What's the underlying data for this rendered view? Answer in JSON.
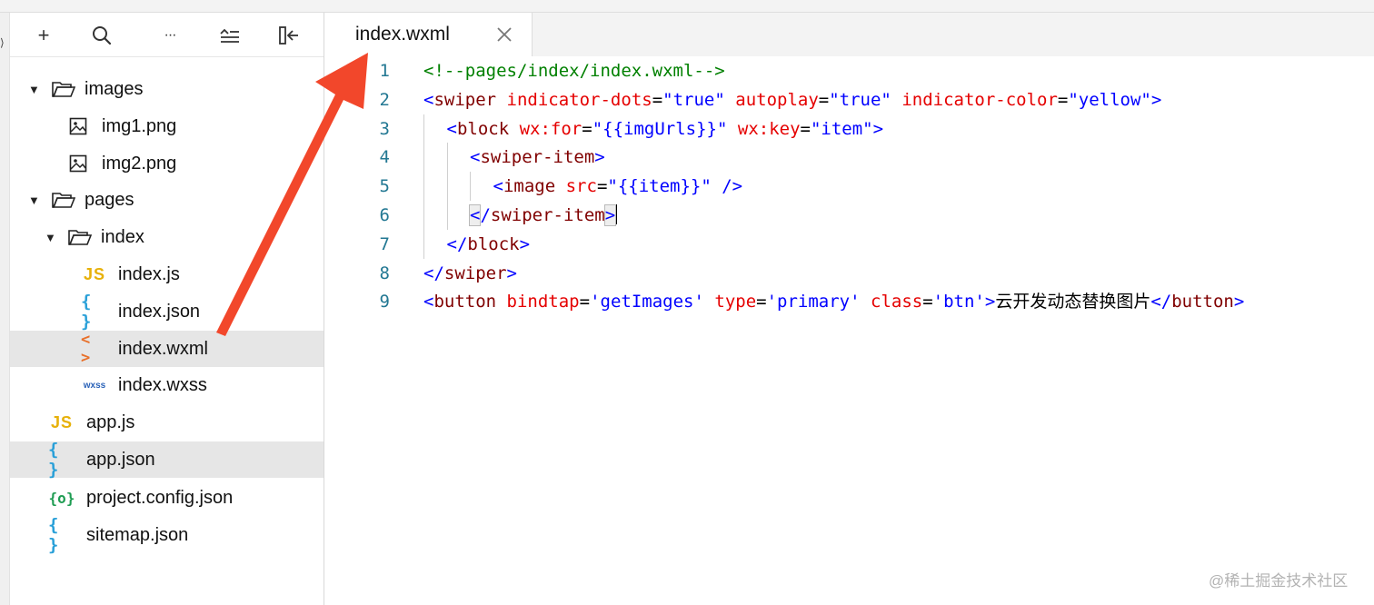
{
  "sidebar": {
    "toolbar": {
      "add": "+",
      "more": "···"
    },
    "tree": [
      {
        "label": "images",
        "type": "folder"
      },
      {
        "label": "img1.png",
        "type": "image"
      },
      {
        "label": "img2.png",
        "type": "image"
      },
      {
        "label": "pages",
        "type": "folder"
      },
      {
        "label": "index",
        "type": "folder"
      },
      {
        "label": "index.js",
        "type": "js",
        "icon": "JS"
      },
      {
        "label": "index.json",
        "type": "json",
        "icon": "{ }"
      },
      {
        "label": "index.wxml",
        "type": "wxml",
        "icon": "< >",
        "selected": true
      },
      {
        "label": "index.wxss",
        "type": "wxss",
        "icon": "wxss"
      },
      {
        "label": "app.js",
        "type": "js",
        "icon": "JS"
      },
      {
        "label": "app.json",
        "type": "json",
        "icon": "{ }",
        "highlighted": true
      },
      {
        "label": "project.config.json",
        "type": "config",
        "icon": "{o}"
      },
      {
        "label": "sitemap.json",
        "type": "json",
        "icon": "{ }"
      }
    ]
  },
  "editor": {
    "tab": {
      "title": "index.wxml"
    },
    "line_numbers": [
      "1",
      "2",
      "3",
      "4",
      "5",
      "6",
      "7",
      "8",
      "9"
    ],
    "lines": [
      [
        {
          "c": "comment",
          "t": "<!--pages/index/index.wxml-->"
        }
      ],
      [
        {
          "c": "br",
          "t": "<"
        },
        {
          "c": "tag",
          "t": "swiper"
        },
        {
          "c": "eq",
          "t": " "
        },
        {
          "c": "attr",
          "t": "indicator-dots"
        },
        {
          "c": "eq",
          "t": "="
        },
        {
          "c": "str",
          "t": "\"true\""
        },
        {
          "c": "eq",
          "t": " "
        },
        {
          "c": "attr",
          "t": "autoplay"
        },
        {
          "c": "eq",
          "t": "="
        },
        {
          "c": "str",
          "t": "\"true\""
        },
        {
          "c": "eq",
          "t": " "
        },
        {
          "c": "attr",
          "t": "indicator-color"
        },
        {
          "c": "eq",
          "t": "="
        },
        {
          "c": "str",
          "t": "\"yellow\""
        },
        {
          "c": "br",
          "t": ">"
        }
      ],
      [
        {
          "c": "br",
          "t": "<"
        },
        {
          "c": "tag",
          "t": "block"
        },
        {
          "c": "eq",
          "t": " "
        },
        {
          "c": "attr",
          "t": "wx:for"
        },
        {
          "c": "eq",
          "t": "="
        },
        {
          "c": "str",
          "t": "\"{{imgUrls}}\""
        },
        {
          "c": "eq",
          "t": " "
        },
        {
          "c": "attr",
          "t": "wx:key"
        },
        {
          "c": "eq",
          "t": "="
        },
        {
          "c": "str",
          "t": "\"item\""
        },
        {
          "c": "br",
          "t": ">"
        }
      ],
      [
        {
          "c": "br",
          "t": "<"
        },
        {
          "c": "tag",
          "t": "swiper-item"
        },
        {
          "c": "br",
          "t": ">"
        }
      ],
      [
        {
          "c": "br",
          "t": "<"
        },
        {
          "c": "tag",
          "t": "image"
        },
        {
          "c": "eq",
          "t": " "
        },
        {
          "c": "attr",
          "t": "src"
        },
        {
          "c": "eq",
          "t": "="
        },
        {
          "c": "str",
          "t": "\"{{item}}\""
        },
        {
          "c": "eq",
          "t": " "
        },
        {
          "c": "br",
          "t": "/>"
        }
      ],
      [
        {
          "c": "br",
          "t": "<",
          "bm": true
        },
        {
          "c": "br",
          "t": "/"
        },
        {
          "c": "tag",
          "t": "swiper-item"
        },
        {
          "c": "br",
          "t": ">",
          "bm": true
        },
        {
          "c": "cursor",
          "t": ""
        }
      ],
      [
        {
          "c": "br",
          "t": "</"
        },
        {
          "c": "tag",
          "t": "block"
        },
        {
          "c": "br",
          "t": ">"
        }
      ],
      [
        {
          "c": "br",
          "t": "</"
        },
        {
          "c": "tag",
          "t": "swiper"
        },
        {
          "c": "br",
          "t": ">"
        }
      ],
      [
        {
          "c": "br",
          "t": "<"
        },
        {
          "c": "tag",
          "t": "button"
        },
        {
          "c": "eq",
          "t": " "
        },
        {
          "c": "attr",
          "t": "bindtap"
        },
        {
          "c": "eq",
          "t": "="
        },
        {
          "c": "str",
          "t": "'getImages'"
        },
        {
          "c": "eq",
          "t": " "
        },
        {
          "c": "attr",
          "t": "type"
        },
        {
          "c": "eq",
          "t": "="
        },
        {
          "c": "str",
          "t": "'primary'"
        },
        {
          "c": "eq",
          "t": " "
        },
        {
          "c": "attr",
          "t": "class"
        },
        {
          "c": "eq",
          "t": "="
        },
        {
          "c": "str",
          "t": "'btn'"
        },
        {
          "c": "br",
          "t": ">"
        },
        {
          "c": "text",
          "t": "云开发动态替换图片"
        },
        {
          "c": "br",
          "t": "</"
        },
        {
          "c": "tag",
          "t": "button"
        },
        {
          "c": "br",
          "t": ">"
        }
      ]
    ],
    "indents": [
      0,
      0,
      1,
      2,
      3,
      2,
      1,
      0,
      0
    ]
  },
  "annotation": {
    "arrow_color": "#f2472b"
  },
  "watermark": "@稀土掘金技术社区"
}
